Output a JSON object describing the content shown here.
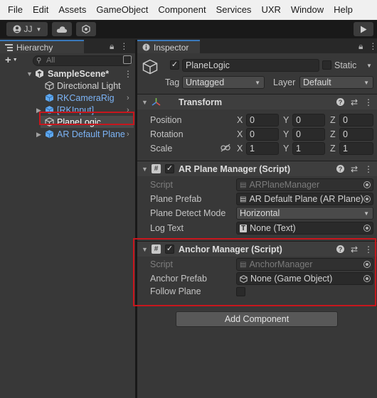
{
  "menu": [
    "File",
    "Edit",
    "Assets",
    "GameObject",
    "Component",
    "Services",
    "UXR",
    "Window",
    "Help"
  ],
  "toolbar": {
    "account": "JJ"
  },
  "hierarchy": {
    "tab_label": "Hierarchy",
    "search_placeholder": "All",
    "scene": "SampleScene*",
    "items": [
      {
        "label": "Directional Light"
      },
      {
        "label": "RKCameraRig"
      },
      {
        "label": "[RKInput]"
      },
      {
        "label": "PlaneLogic"
      },
      {
        "label": "AR Default Plane"
      }
    ]
  },
  "inspector": {
    "tab_label": "Inspector",
    "object_name": "PlaneLogic",
    "static_label": "Static",
    "tag_label": "Tag",
    "tag_value": "Untagged",
    "layer_label": "Layer",
    "layer_value": "Default",
    "transform": {
      "title": "Transform",
      "rows": [
        {
          "label": "Position",
          "x": "0",
          "y": "0",
          "z": "0"
        },
        {
          "label": "Rotation",
          "x": "0",
          "y": "0",
          "z": "0"
        },
        {
          "label": "Scale",
          "x": "1",
          "y": "1",
          "z": "1"
        }
      ],
      "axis": {
        "x": "X",
        "y": "Y",
        "z": "Z"
      }
    },
    "ar_plane_manager": {
      "title": "AR Plane Manager (Script)",
      "script_label": "Script",
      "script_value": "ARPlaneManager",
      "plane_prefab_label": "Plane Prefab",
      "plane_prefab_value": "AR Default Plane (AR Plane)",
      "detect_mode_label": "Plane Detect Mode",
      "detect_mode_value": "Horizontal",
      "log_text_label": "Log Text",
      "log_text_value": "None (Text)"
    },
    "anchor_manager": {
      "title": "Anchor Manager (Script)",
      "script_label": "Script",
      "script_value": "AnchorManager",
      "anchor_prefab_label": "Anchor Prefab",
      "anchor_prefab_value": "None (Game Object)",
      "follow_plane_label": "Follow Plane"
    },
    "add_component_label": "Add Component"
  },
  "colors": {
    "highlight": "#c8161d",
    "prefab_blue": "#7cb4f6",
    "tab_accent": "#3a79bb"
  }
}
